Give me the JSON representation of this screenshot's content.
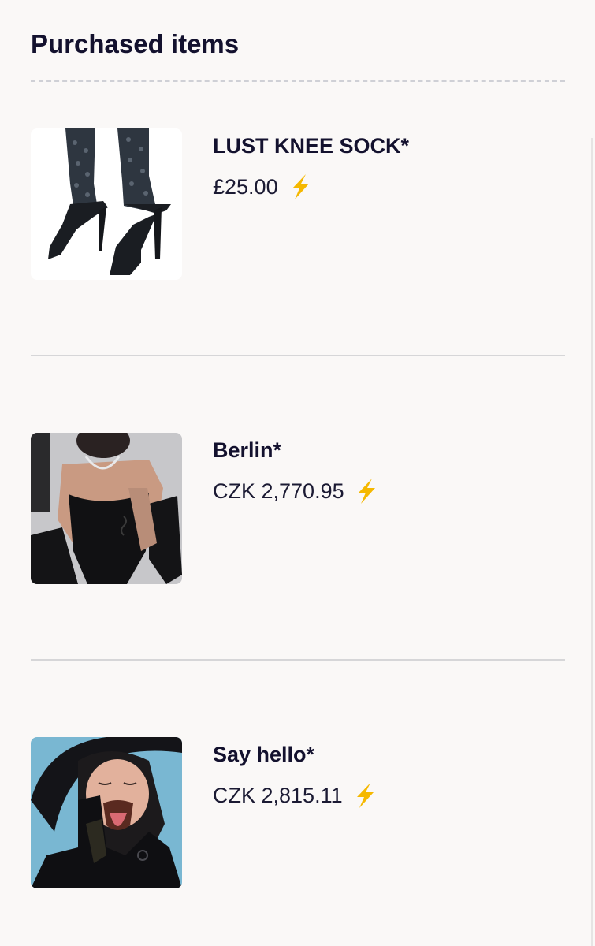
{
  "header": {
    "title": "Purchased items"
  },
  "items": [
    {
      "name": "LUST KNEE SOCK*",
      "price": "£25.00",
      "badge_icon": "lightning-bolt-icon",
      "image": "product-photo-lace-socks-heels"
    },
    {
      "name": "Berlin*",
      "price": "CZK 2,770.95",
      "badge_icon": "lightning-bolt-icon",
      "image": "product-photo-black-latex-outfit"
    },
    {
      "name": "Say hello*",
      "price": "CZK 2,815.11",
      "badge_icon": "lightning-bolt-icon",
      "image": "product-photo-portrait-blue-background"
    }
  ],
  "colors": {
    "background": "#faf8f7",
    "text": "#13112e",
    "divider": "#d6d6d8",
    "bolt": "#f5b800"
  }
}
